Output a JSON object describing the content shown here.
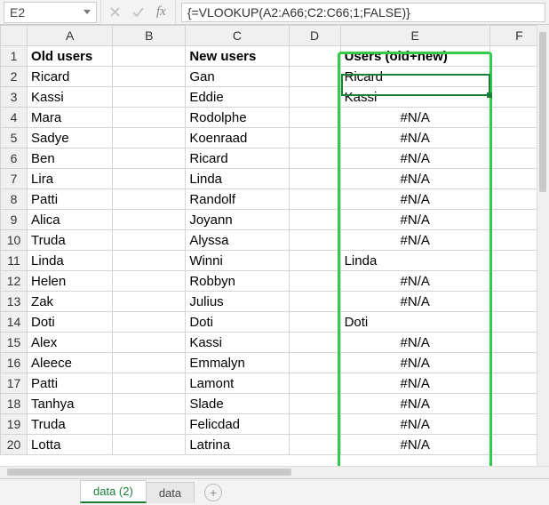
{
  "formula_bar": {
    "name_box": "E2",
    "formula": "{=VLOOKUP(A2:A66;C2:C66;1;FALSE)}"
  },
  "columns": [
    "A",
    "B",
    "C",
    "D",
    "E",
    "F"
  ],
  "headers": {
    "A": "Old users",
    "C": "New users",
    "E": "Users (old+new)"
  },
  "rows": [
    {
      "n": 2,
      "A": "Ricard",
      "C": "Gan",
      "E": "Ricard",
      "Ea": "left"
    },
    {
      "n": 3,
      "A": "Kassi",
      "C": "Eddie",
      "E": "Kassi",
      "Ea": "left"
    },
    {
      "n": 4,
      "A": "Mara",
      "C": "Rodolphe",
      "E": "#N/A",
      "Ea": "center"
    },
    {
      "n": 5,
      "A": "Sadye",
      "C": "Koenraad",
      "E": "#N/A",
      "Ea": "center"
    },
    {
      "n": 6,
      "A": "Ben",
      "C": "Ricard",
      "E": "#N/A",
      "Ea": "center"
    },
    {
      "n": 7,
      "A": "Lira",
      "C": "Linda",
      "E": "#N/A",
      "Ea": "center"
    },
    {
      "n": 8,
      "A": "Patti",
      "C": "Randolf",
      "E": "#N/A",
      "Ea": "center"
    },
    {
      "n": 9,
      "A": "Alica",
      "C": "Joyann",
      "E": "#N/A",
      "Ea": "center"
    },
    {
      "n": 10,
      "A": "Truda",
      "C": "Alyssa",
      "E": "#N/A",
      "Ea": "center"
    },
    {
      "n": 11,
      "A": "Linda",
      "C": "Winni",
      "E": "Linda",
      "Ea": "left"
    },
    {
      "n": 12,
      "A": "Helen",
      "C": "Robbyn",
      "E": "#N/A",
      "Ea": "center"
    },
    {
      "n": 13,
      "A": "Zak",
      "C": "Julius",
      "E": "#N/A",
      "Ea": "center"
    },
    {
      "n": 14,
      "A": "Doti",
      "C": "Doti",
      "E": "Doti",
      "Ea": "left"
    },
    {
      "n": 15,
      "A": "Alex",
      "C": "Kassi",
      "E": "#N/A",
      "Ea": "center"
    },
    {
      "n": 16,
      "A": "Aleece",
      "C": "Emmalyn",
      "E": "#N/A",
      "Ea": "center"
    },
    {
      "n": 17,
      "A": "Patti",
      "C": "Lamont",
      "E": "#N/A",
      "Ea": "center"
    },
    {
      "n": 18,
      "A": "Tanhya",
      "C": "Slade",
      "E": "#N/A",
      "Ea": "center"
    },
    {
      "n": 19,
      "A": "Truda",
      "C": "Felicdad",
      "E": "#N/A",
      "Ea": "center"
    },
    {
      "n": 20,
      "A": "Lotta",
      "C": "Latrina",
      "E": "#N/A",
      "Ea": "center"
    }
  ],
  "tabs": {
    "active": "data (2)",
    "others": [
      "data"
    ]
  }
}
